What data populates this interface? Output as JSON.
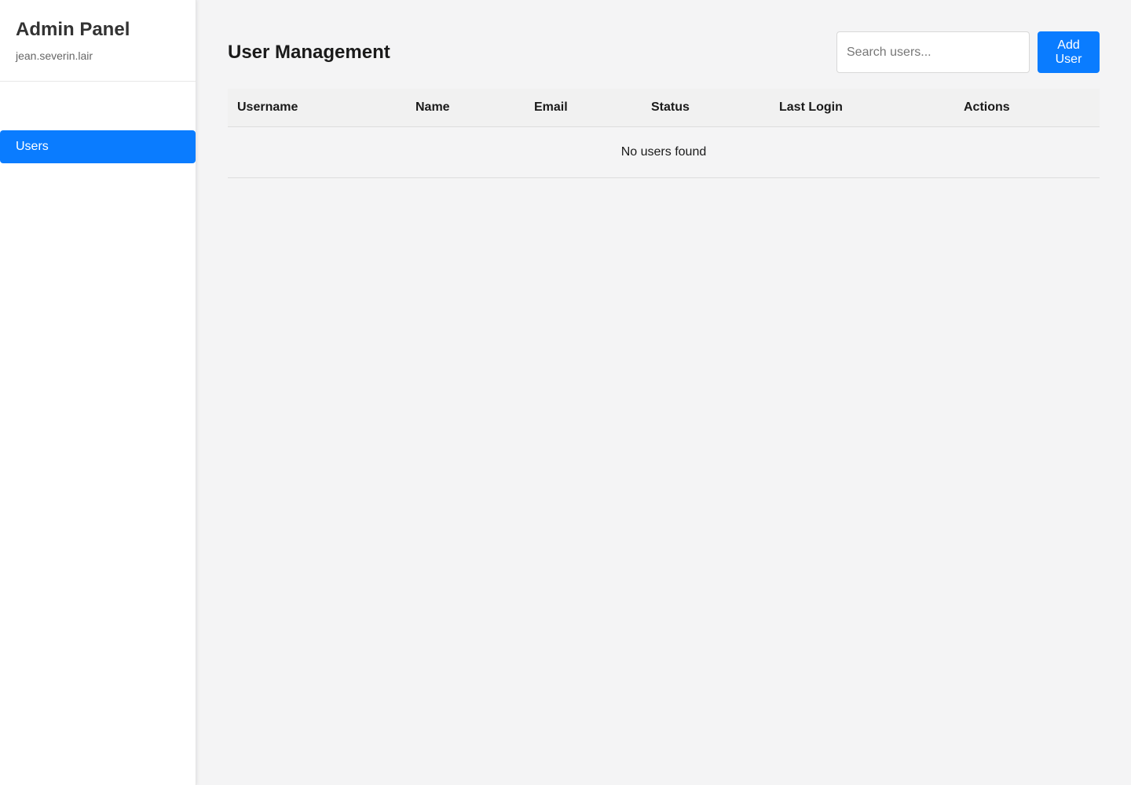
{
  "sidebar": {
    "title": "Admin Panel",
    "user": "jean.severin.lair",
    "items": [
      {
        "label": "Users",
        "active": true
      }
    ]
  },
  "header": {
    "title": "User Management",
    "search_placeholder": "Search users...",
    "search_value": "",
    "add_button_label": "Add User"
  },
  "table": {
    "columns": [
      "Username",
      "Name",
      "Email",
      "Status",
      "Last Login",
      "Actions"
    ],
    "rows": [],
    "empty_message": "No users found"
  },
  "colors": {
    "accent": "#0a7cff",
    "background": "#f4f4f5",
    "sidebar": "#ffffff"
  }
}
